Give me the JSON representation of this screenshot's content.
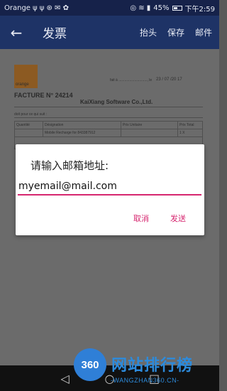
{
  "status_bar": {
    "carrier": "Orange",
    "usb_icons": "ψ ψ ⊛ ✉ ✿",
    "right_icons": "◎ ≋ ▮",
    "battery": "45%",
    "time": "下午2:59"
  },
  "app_bar": {
    "back_icon": "←",
    "title": "发票",
    "actions": [
      "抬头",
      "保存",
      "邮件"
    ]
  },
  "document": {
    "logo_text": "orange",
    "fait_text": "fait à ............................., le",
    "date": "23 / 07 /20 17",
    "facture": "FACTURE N° 24214",
    "company": "KaiXiang Software Co.,Ltd.",
    "small_text": "doit pour ce qui suit :",
    "table_headers": [
      "Quantité",
      "Désignation",
      "Prix Unitaire",
      "Prix Total"
    ],
    "table_row": [
      "",
      "Mobile Recharge for 843387912",
      "",
      "1 X"
    ]
  },
  "dialog": {
    "title": "请输入邮箱地址:",
    "email_value": "myemail@mail.com",
    "cancel_label": "取消",
    "send_label": "发送"
  },
  "nav_bar": {
    "back": "◁",
    "home": "○",
    "recent": "□"
  },
  "watermark": {
    "logo": "360",
    "title": "网站排行榜",
    "url": "-WANGZHAN360.CN-"
  }
}
